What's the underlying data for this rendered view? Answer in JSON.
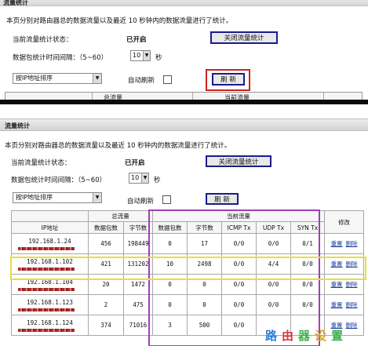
{
  "top": {
    "title": "流量统计",
    "description": "本页分别对路由器总的数据流量以及最近 10 秒钟内的数据流量进行了统计。",
    "status_label": "当前流量统计状态：",
    "status_value": "已开启",
    "stop_button": "关闭流量统计",
    "interval_label": "数据包统计时间间隔：（5~60）",
    "interval_value": "10",
    "interval_unit": "秒",
    "sort_value": "按IP地址排序",
    "auto_refresh_label": "自动刷新",
    "refresh_button": "刷 新",
    "table_header_total": "总流量",
    "table_header_current": "当前流量"
  },
  "bottom": {
    "title": "流量统计",
    "description": "本页分别对路由器总的数据流量以及最近 10 秒钟内的数据流量进行了统计。",
    "status_label": "当前流量统计状态：",
    "status_value": "已开启",
    "stop_button": "关闭流量统计",
    "interval_label": "数据包统计时间间隔：（5~60）",
    "interval_value": "10",
    "interval_unit": "秒",
    "sort_value": "按IP地址排序",
    "auto_refresh_label": "自动刷新",
    "refresh_button": "刷 新",
    "table": {
      "group_total": "总流量",
      "group_current": "当前流量",
      "col_ip": "IP地址",
      "col_action": "修改",
      "cols": [
        "数据包数",
        "字节数",
        "数据包数",
        "字节数",
        "ICMP Tx",
        "UDP Tx",
        "SYN Tx"
      ],
      "reset_label": "重置",
      "delete_label": "删除",
      "rows": [
        {
          "ip": "192.168.1.24",
          "cells": [
            "456",
            "198449",
            "0",
            "17",
            "0/0",
            "0/0",
            "0/1"
          ]
        },
        {
          "ip": "192.168.1.102",
          "cells": [
            "421",
            "131202",
            "10",
            "2498",
            "0/0",
            "4/4",
            "0/0"
          ]
        },
        {
          "ip": "192.168.1.104",
          "cells": [
            "20",
            "1472",
            "0",
            "0",
            "0/0",
            "0/0",
            "0/0"
          ]
        },
        {
          "ip": "192.168.1.123",
          "cells": [
            "2",
            "475",
            "0",
            "0",
            "0/0",
            "0/0",
            "0/0"
          ]
        },
        {
          "ip": "192.168.1.124",
          "cells": [
            "374",
            "71016",
            "3",
            "500",
            "0/0",
            "",
            ""
          ]
        }
      ]
    }
  },
  "watermark": {
    "c1": "路",
    "c2": "由",
    "c3": "器",
    "c4": "设",
    "c5": "置"
  },
  "colors": {
    "highlight_red": "#cc2222",
    "highlight_purple": "#a03fb8",
    "highlight_yellow": "#e7df3a",
    "button_border": "#1b1b8c",
    "link": "#1a3e9c"
  }
}
